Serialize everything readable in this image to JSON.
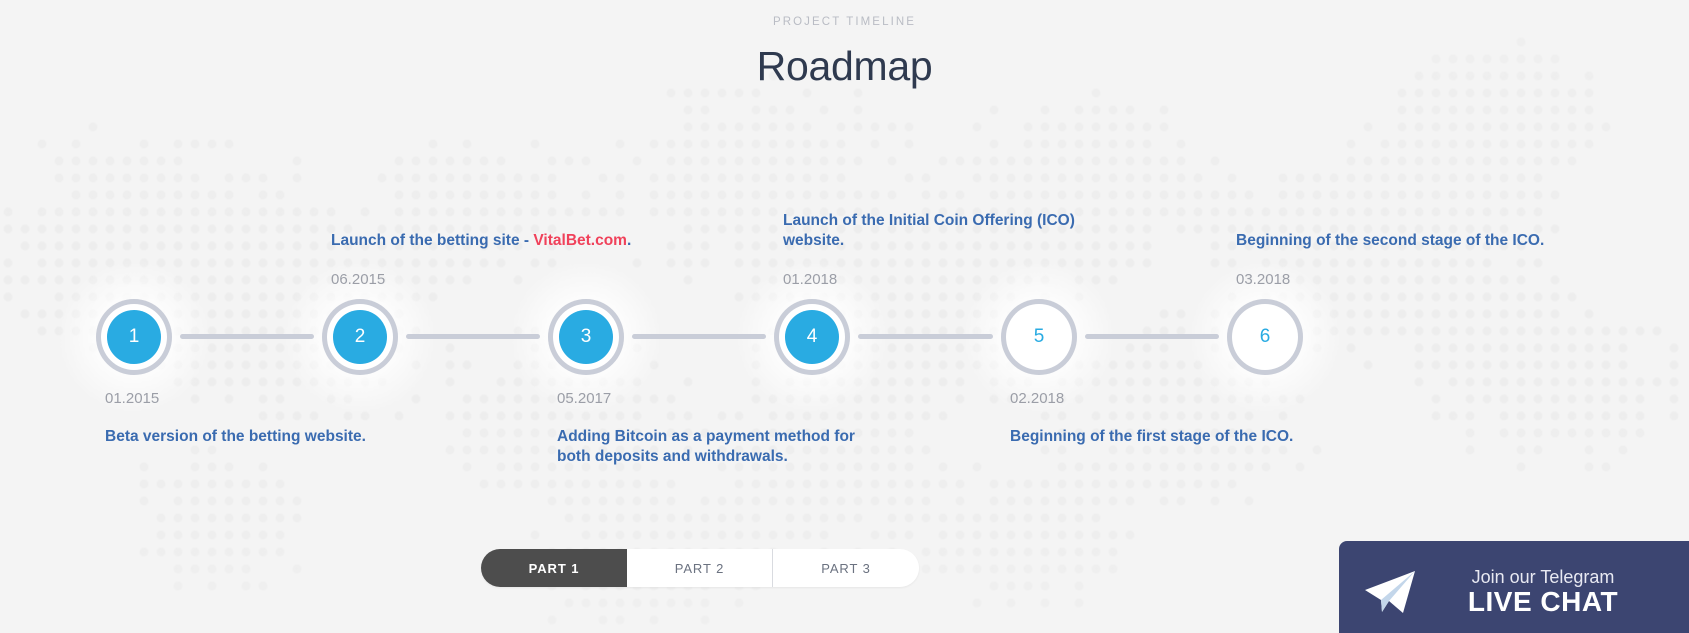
{
  "header": {
    "eyebrow": "PROJECT TIMELINE",
    "title": "Roadmap"
  },
  "timeline": {
    "milestones": [
      {
        "number": "1",
        "date": "01.2015",
        "desc_prefix": "Beta version of the betting website.",
        "desc_accent": "",
        "desc_suffix": "",
        "position": "below",
        "state": "filled"
      },
      {
        "number": "2",
        "date": "06.2015",
        "desc_prefix": "Launch of the betting site - ",
        "desc_accent": "VitalBet.com",
        "desc_suffix": ".",
        "position": "above",
        "state": "filled"
      },
      {
        "number": "3",
        "date": "05.2017",
        "desc_prefix": "Adding Bitcoin as a payment method for both deposits and withdrawals.",
        "desc_accent": "",
        "desc_suffix": "",
        "position": "below",
        "state": "filled"
      },
      {
        "number": "4",
        "date": "01.2018",
        "desc_prefix": "Launch of the Initial Coin Offering (ICO) website.",
        "desc_accent": "",
        "desc_suffix": "",
        "position": "above",
        "state": "filled"
      },
      {
        "number": "5",
        "date": "02.2018",
        "desc_prefix": "Beginning of the first stage of the ICO.",
        "desc_accent": "",
        "desc_suffix": "",
        "position": "below",
        "state": "hollow"
      },
      {
        "number": "6",
        "date": "03.2018",
        "desc_prefix": "Beginning of the second stage of the ICO.",
        "desc_accent": "",
        "desc_suffix": "",
        "position": "above",
        "state": "hollow"
      }
    ]
  },
  "tabs": [
    {
      "label": "PART 1",
      "active": true
    },
    {
      "label": "PART 2",
      "active": false
    },
    {
      "label": "PART 3",
      "active": false
    }
  ],
  "telegram": {
    "icon": "paper-plane-icon",
    "line1": "Join our Telegram",
    "line2": "LIVE CHAT"
  },
  "colors": {
    "accent_cyan": "#29abe2",
    "accent_red": "#f0415a",
    "text_blue": "#3a6bb0",
    "title_navy": "#2f3a4f",
    "muted_grey": "#9b9ea7",
    "rail_grey": "#c9cdd8",
    "tab_active_bg": "#4d4d4d",
    "telegram_bg": "#3c4571",
    "page_bg": "#f4f4f4"
  }
}
